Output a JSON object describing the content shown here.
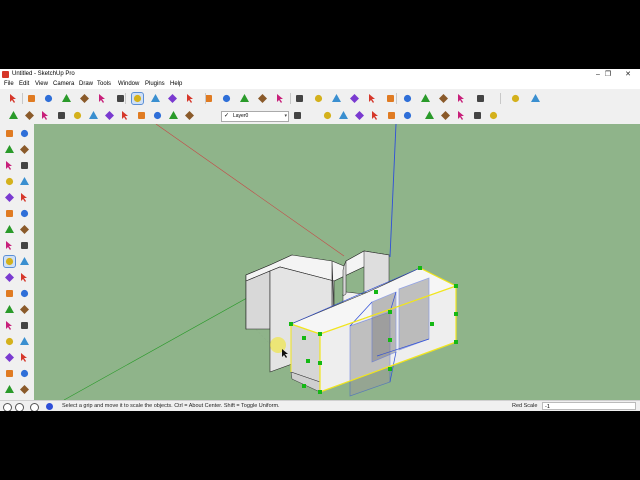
{
  "window": {
    "title": "Untitled - SketchUp Pro",
    "minimize": "–",
    "maximize": "❐",
    "close": "✕"
  },
  "menu": [
    {
      "label": "File"
    },
    {
      "label": "Edit"
    },
    {
      "label": "View"
    },
    {
      "label": "Camera"
    },
    {
      "label": "Draw"
    },
    {
      "label": "Tools"
    },
    {
      "label": "Window"
    },
    {
      "label": "Plugins"
    },
    {
      "label": "Help"
    }
  ],
  "layers": {
    "current": "Layer0",
    "check": "✓",
    "arrow": "▾"
  },
  "status": {
    "message": "Select a grip and move it to scale the objects. Ctrl = About Center. Shift = Toggle Uniform.",
    "measure_label": "Red Scale",
    "measure_value": "-1"
  },
  "colors": {
    "viewport": "#8fb48a",
    "selection": "#f2e61c",
    "grip": "#14b814",
    "axis_red": "#c84646",
    "axis_green": "#2a9a2a",
    "axis_blue": "#2f4fd8",
    "active_tool": "#cfe0f7"
  },
  "toolbar_main": [
    {
      "icon": "select-arrow-icon"
    },
    {
      "icon": "eraser-icon"
    },
    {
      "icon": "pencil-icon"
    },
    {
      "icon": "arc-icon"
    },
    {
      "icon": "push-pull-icon"
    },
    {
      "icon": "move-icon"
    },
    {
      "icon": "rotate-icon"
    },
    {
      "icon": "scale-icon"
    },
    {
      "icon": "tape-measure-icon"
    },
    {
      "icon": "dimension-icon"
    },
    {
      "icon": "text-icon"
    },
    {
      "icon": "paint-bucket-icon"
    },
    {
      "icon": "orbit-icon"
    },
    {
      "icon": "pan-icon"
    },
    {
      "icon": "zoom-icon"
    },
    {
      "icon": "zoom-extents-icon"
    },
    {
      "icon": "warehouse-icon"
    },
    {
      "icon": "share-model-icon"
    },
    {
      "icon": "components-icon"
    },
    {
      "icon": "extension-icon"
    },
    {
      "icon": "iso-view-icon"
    },
    {
      "icon": "top-view-icon"
    },
    {
      "icon": "front-view-icon"
    },
    {
      "icon": "right-view-icon"
    },
    {
      "icon": "back-view-icon"
    },
    {
      "icon": "left-view-icon"
    },
    {
      "icon": "section-plane-icon"
    },
    {
      "icon": "xray-icon"
    },
    {
      "icon": "styles-icon"
    }
  ],
  "toolbar_secondary": [
    {
      "icon": "component-icon"
    },
    {
      "icon": "tag-icon"
    },
    {
      "icon": "sphere-icon"
    },
    {
      "icon": "globe-icon"
    },
    {
      "icon": "gear-icon"
    },
    {
      "icon": "help-icon"
    },
    {
      "icon": "dot-icon"
    },
    {
      "icon": "sandbox-icon"
    },
    {
      "icon": "flip-icon"
    },
    {
      "icon": "shadow-icon"
    },
    {
      "icon": "fog-icon"
    },
    {
      "icon": "info-icon"
    }
  ],
  "toolbar_layers": [
    {
      "icon": "layer-manager-icon"
    },
    {
      "icon": "point-icon"
    },
    {
      "icon": "flag-icon"
    },
    {
      "icon": "eye-icon"
    },
    {
      "icon": "sun-icon"
    },
    {
      "icon": "lamp-icon"
    },
    {
      "icon": "cube-icon"
    },
    {
      "icon": "wireframe-icon"
    },
    {
      "icon": "hidden-line-icon"
    },
    {
      "icon": "shaded-icon"
    },
    {
      "icon": "textured-icon"
    },
    {
      "icon": "monochrome-icon"
    }
  ],
  "left_tools": [
    {
      "icon": "select-arrow-icon"
    },
    {
      "icon": "make-component-icon"
    },
    {
      "icon": "paint-bucket-icon"
    },
    {
      "icon": "eraser-icon"
    },
    {
      "icon": "rectangle-icon"
    },
    {
      "icon": "line-icon"
    },
    {
      "icon": "circle-icon"
    },
    {
      "icon": "freehand-icon"
    },
    {
      "icon": "polygon-icon"
    },
    {
      "icon": "arc-icon"
    },
    {
      "icon": "pie-icon"
    },
    {
      "icon": "two-point-arc-icon"
    },
    {
      "icon": "move-icon"
    },
    {
      "icon": "push-pull-icon"
    },
    {
      "icon": "rotate-icon"
    },
    {
      "icon": "follow-me-icon"
    },
    {
      "icon": "scale-icon"
    },
    {
      "icon": "offset-icon"
    },
    {
      "icon": "tape-measure-icon"
    },
    {
      "icon": "dimension-icon"
    },
    {
      "icon": "protractor-icon"
    },
    {
      "icon": "text-icon"
    },
    {
      "icon": "axes-icon"
    },
    {
      "icon": "3d-text-icon"
    },
    {
      "icon": "orbit-icon"
    },
    {
      "icon": "pan-icon"
    },
    {
      "icon": "zoom-icon"
    },
    {
      "icon": "zoom-window-icon"
    },
    {
      "icon": "zoom-extents-icon"
    },
    {
      "icon": "previous-view-icon"
    },
    {
      "icon": "position-camera-icon"
    },
    {
      "icon": "look-around-icon"
    },
    {
      "icon": "walk-icon"
    },
    {
      "icon": "section-plane-icon"
    }
  ]
}
